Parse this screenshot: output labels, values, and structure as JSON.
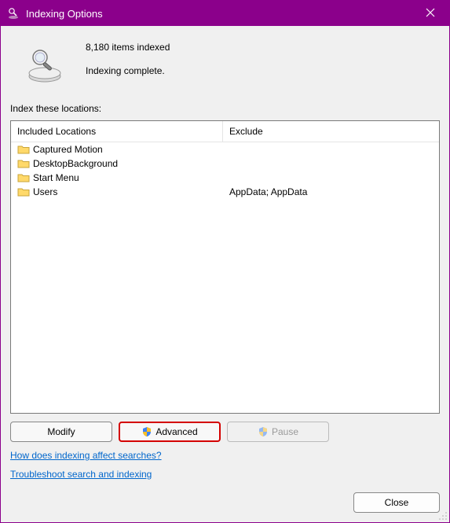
{
  "title": "Indexing Options",
  "status": {
    "count_text": "8,180 items indexed",
    "state_text": "Indexing complete."
  },
  "locations_label": "Index these locations:",
  "columns": {
    "included": "Included Locations",
    "exclude": "Exclude"
  },
  "rows": [
    {
      "name": "Captured Motion",
      "exclude": ""
    },
    {
      "name": "DesktopBackground",
      "exclude": ""
    },
    {
      "name": "Start Menu",
      "exclude": ""
    },
    {
      "name": "Users",
      "exclude": "AppData; AppData"
    }
  ],
  "buttons": {
    "modify": "Modify",
    "advanced": "Advanced",
    "pause": "Pause",
    "close": "Close"
  },
  "links": {
    "affect": "How does indexing affect searches?",
    "troubleshoot": "Troubleshoot search and indexing"
  }
}
